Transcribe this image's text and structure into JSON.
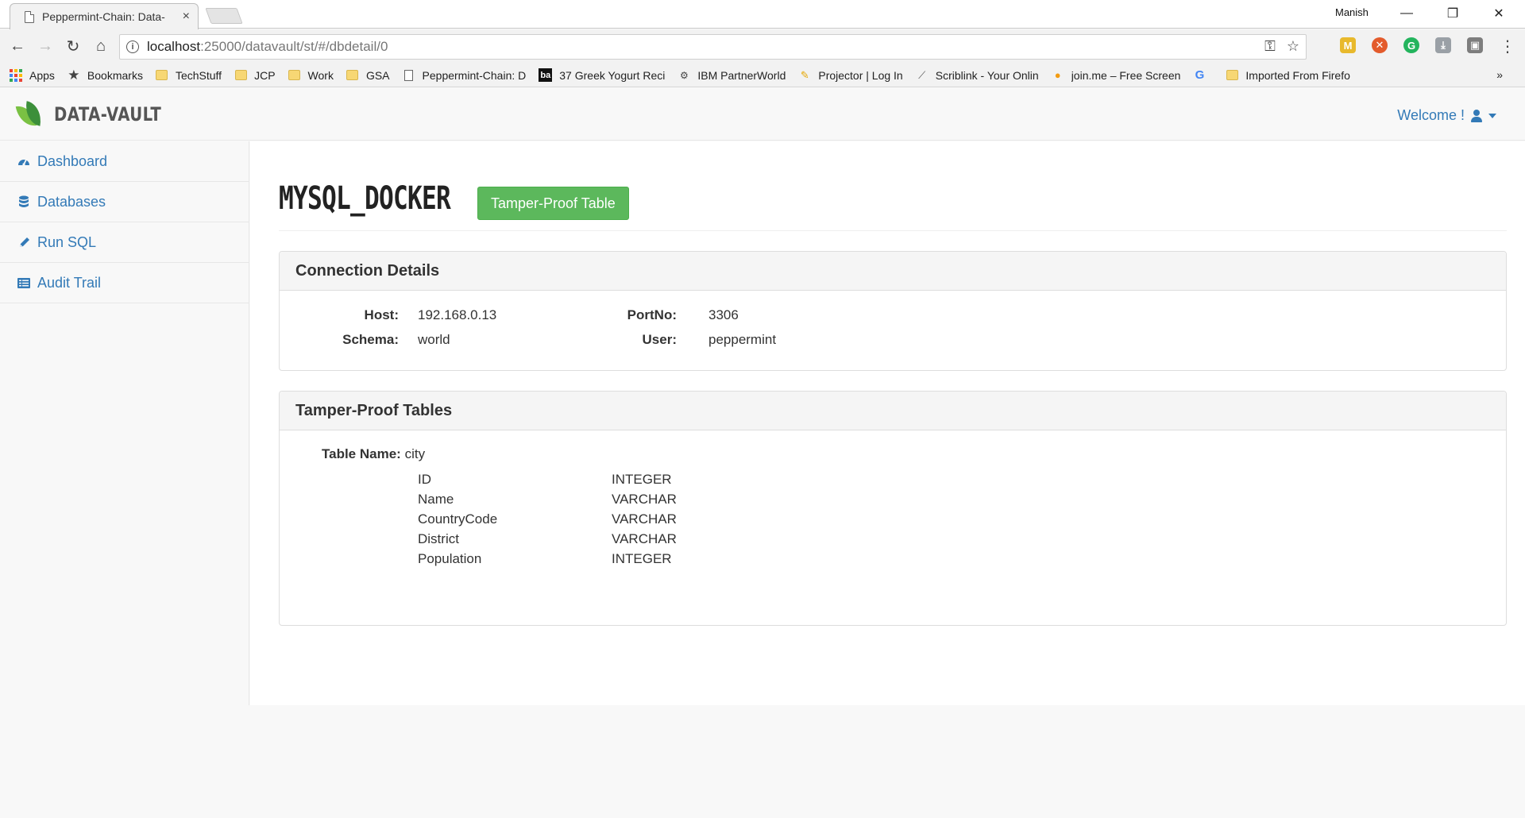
{
  "browser": {
    "tab_title": "Peppermint-Chain: Data-",
    "tab_close": "×",
    "profile_name": "Manish",
    "window_controls": {
      "minimize": "—",
      "restore": "❐",
      "close": "✕"
    },
    "nav": {
      "back": "←",
      "forward": "→",
      "reload": "↻",
      "home": "⌂"
    },
    "url_host": "localhost",
    "url_path": ":25000/datavault/st/#/dbdetail/0",
    "omnibox_icons": {
      "key": "⚿",
      "star": "☆"
    },
    "extensions": [
      {
        "label": "M",
        "color": "#e8b92c"
      },
      {
        "label": "✕",
        "color": "#e35b2c"
      },
      {
        "label": "G",
        "color": "#23b45d"
      },
      {
        "label": "⤓",
        "color": "#9aa0a6"
      },
      {
        "label": "▣",
        "color": "#7d7d7d"
      }
    ],
    "menu": "⋮",
    "bookmarks": [
      {
        "label": "Apps",
        "icon": "apps-grid"
      },
      {
        "label": "Bookmarks",
        "icon": "star"
      },
      {
        "label": "TechStuff",
        "icon": "folder"
      },
      {
        "label": "JCP",
        "icon": "folder"
      },
      {
        "label": "Work",
        "icon": "folder"
      },
      {
        "label": "GSA",
        "icon": "folder"
      },
      {
        "label": "Peppermint-Chain: D",
        "icon": "page"
      },
      {
        "label": "37 Greek Yogurt Reci",
        "icon": "ba"
      },
      {
        "label": "IBM PartnerWorld",
        "icon": "ibm"
      },
      {
        "label": "Projector  | Log In",
        "icon": "projector"
      },
      {
        "label": "Scriblink - Your Onlin",
        "icon": "pen"
      },
      {
        "label": "join.me – Free Screen",
        "icon": "joinme"
      },
      {
        "label": "",
        "icon": "google"
      },
      {
        "label": "Imported From Firefo",
        "icon": "folder"
      }
    ],
    "bookmarks_more": "»"
  },
  "app": {
    "brand": "DATA-VAULT",
    "welcome": "Welcome !",
    "colors": {
      "link": "#337ab7",
      "success": "#5cb85c",
      "brand_leaf_dark": "#3c8f3a",
      "brand_leaf_light": "#7ac143"
    },
    "sidebar": [
      {
        "label": "Dashboard",
        "icon": "tachometer-icon"
      },
      {
        "label": "Databases",
        "icon": "database-icon"
      },
      {
        "label": "Run SQL",
        "icon": "pencil-icon"
      },
      {
        "label": "Audit Trail",
        "icon": "list-icon"
      }
    ],
    "page": {
      "title": "MYSQL_DOCKER",
      "action_button": "Tamper-Proof Table"
    },
    "connection": {
      "heading": "Connection Details",
      "host_label": "Host:",
      "host": "192.168.0.13",
      "port_label": "PortNo:",
      "port": "3306",
      "schema_label": "Schema:",
      "schema": "world",
      "user_label": "User:",
      "user": "peppermint"
    },
    "tables": {
      "heading": "Tamper-Proof Tables",
      "table_name_label": "Table Name:",
      "table_name": "city",
      "columns": [
        {
          "name": "ID",
          "type": "INTEGER"
        },
        {
          "name": "Name",
          "type": "VARCHAR"
        },
        {
          "name": "CountryCode",
          "type": "VARCHAR"
        },
        {
          "name": "District",
          "type": "VARCHAR"
        },
        {
          "name": "Population",
          "type": "INTEGER"
        }
      ]
    }
  }
}
